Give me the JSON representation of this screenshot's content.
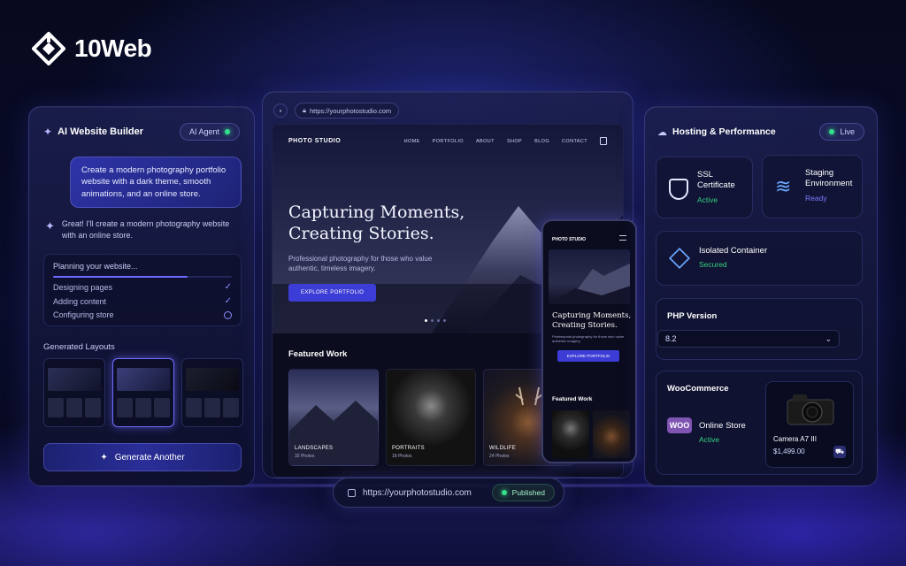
{
  "brand": {
    "name": "10Web"
  },
  "ai_builder": {
    "title": "AI Website Builder",
    "badge": "AI Agent",
    "prompt": "Create a modern photography portfolio website with a dark theme, smooth animations, and an online store.",
    "reply": "Great! I'll create a modern photography website with an online store.",
    "plan": {
      "title": "Planning your website...",
      "progress": 0.75,
      "steps": [
        {
          "label": "Designing pages",
          "status": "done"
        },
        {
          "label": "Adding content",
          "status": "done"
        },
        {
          "label": "Configuring store",
          "status": "pending"
        }
      ]
    },
    "layouts_title": "Generated Layouts",
    "generate_label": "Generate Another"
  },
  "browser": {
    "url": "https://yourphotostudio.com",
    "site": {
      "brand": "PHOTO STUDIO",
      "nav": [
        "HOME",
        "PORTFOLIO",
        "ABOUT",
        "SHOP",
        "BLOG",
        "CONTACT"
      ],
      "hero_title_1": "Capturing Moments,",
      "hero_title_2": "Creating Stories.",
      "hero_text": "Professional photography for those who value authentic, timeless imagery.",
      "hero_button": "EXPLORE PORTFOLIO",
      "featured_title": "Featured Work",
      "cards": [
        {
          "label": "LANDSCAPES",
          "count": "32 Photos"
        },
        {
          "label": "PORTRAITS",
          "count": "18 Photos"
        },
        {
          "label": "WILDLIFE",
          "count": "24 Photos"
        }
      ]
    }
  },
  "mobile": {
    "brand": "PHOTO STUDIO",
    "hero_title_1": "Capturing Moments,",
    "hero_title_2": "Creating Stories.",
    "hero_text": "Professional photography for those who value authentic imagery.",
    "hero_button": "EXPLORE PORTFOLIO",
    "featured_title": "Featured Work"
  },
  "hosting": {
    "title": "Hosting & Performance",
    "badge": "Live",
    "ssl": {
      "name_1": "SSL",
      "name_2": "Certificate",
      "status": "Active"
    },
    "staging": {
      "name_1": "Staging",
      "name_2": "Environment",
      "status": "Ready"
    },
    "container": {
      "name": "Isolated Container",
      "status": "Secured"
    },
    "php": {
      "title": "PHP Version",
      "value": "8.2"
    },
    "woo": {
      "title": "WooCommerce",
      "logo": "WOO",
      "name": "Online Store",
      "status": "Active",
      "product": {
        "name": "Camera A7 III",
        "price": "$1,499.00"
      }
    }
  },
  "published": {
    "url": "https://yourphotostudio.com",
    "status": "Published"
  },
  "colors": {
    "accent": "#3c3cd6",
    "success": "#35d07f",
    "woo": "#7f54b3"
  }
}
